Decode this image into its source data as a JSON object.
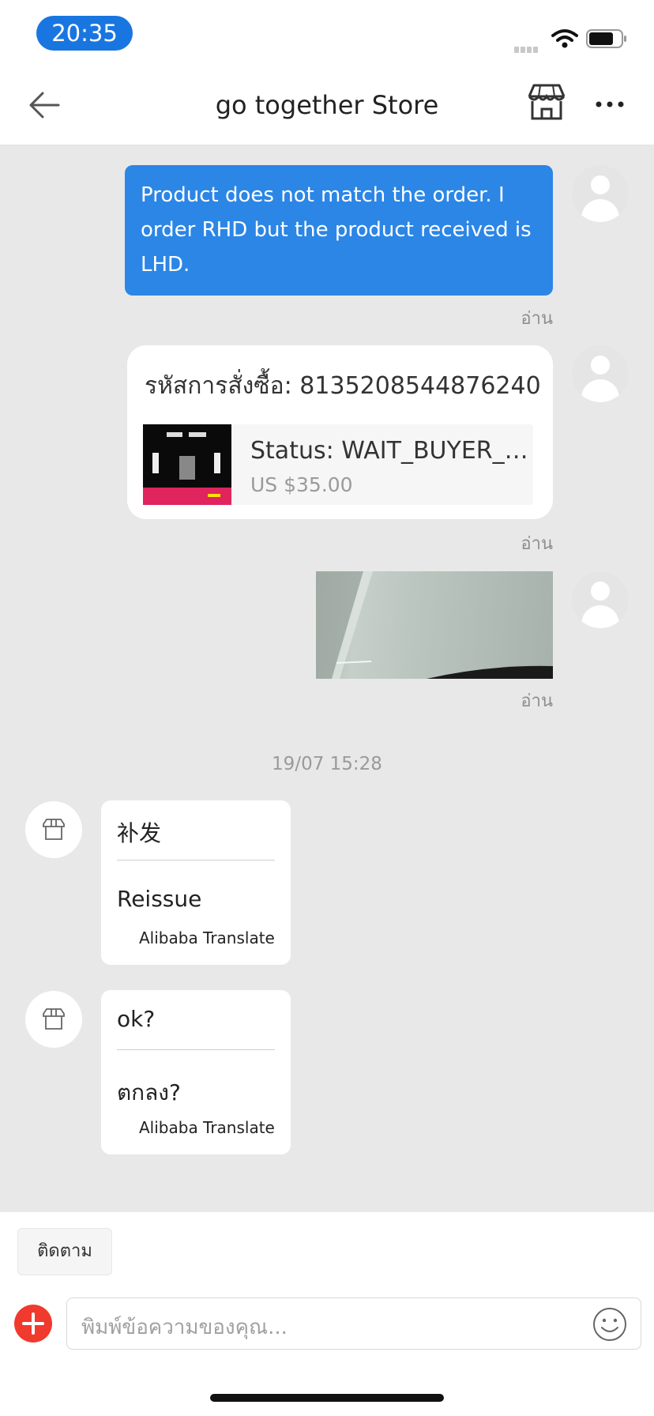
{
  "status_bar": {
    "time": "20:35"
  },
  "header": {
    "title": "go together Store"
  },
  "messages": {
    "text_message": "Product does not match the order. I order RHD but the product received is LHD.",
    "read_label": "อ่าน",
    "order_card": {
      "title": "รหัสการสั่งซื้อ: 8135208544876240",
      "status": "Status:  WAIT_BUYER_A...",
      "price": "US $35.00"
    },
    "timestamp": "19/07 15:28",
    "store_messages": [
      {
        "original": "补发",
        "translation": "Reissue",
        "credit": "Alibaba Translate"
      },
      {
        "original": "ok?",
        "translation": "ตกลง?",
        "credit": "Alibaba Translate"
      }
    ]
  },
  "bottom_bar": {
    "follow_label": "ติดตาม",
    "input_placeholder": "พิมพ์ข้อความของคุณ..."
  },
  "colors": {
    "accent_blue": "#2b86e6",
    "add_button_red": "#f03a2e",
    "chat_background": "#e8e8e8"
  },
  "icons": [
    "back-arrow-icon",
    "store-icon",
    "more-icon",
    "wifi-icon",
    "battery-icon",
    "user-avatar-icon",
    "store-avatar-icon",
    "plus-icon",
    "emoji-icon"
  ]
}
